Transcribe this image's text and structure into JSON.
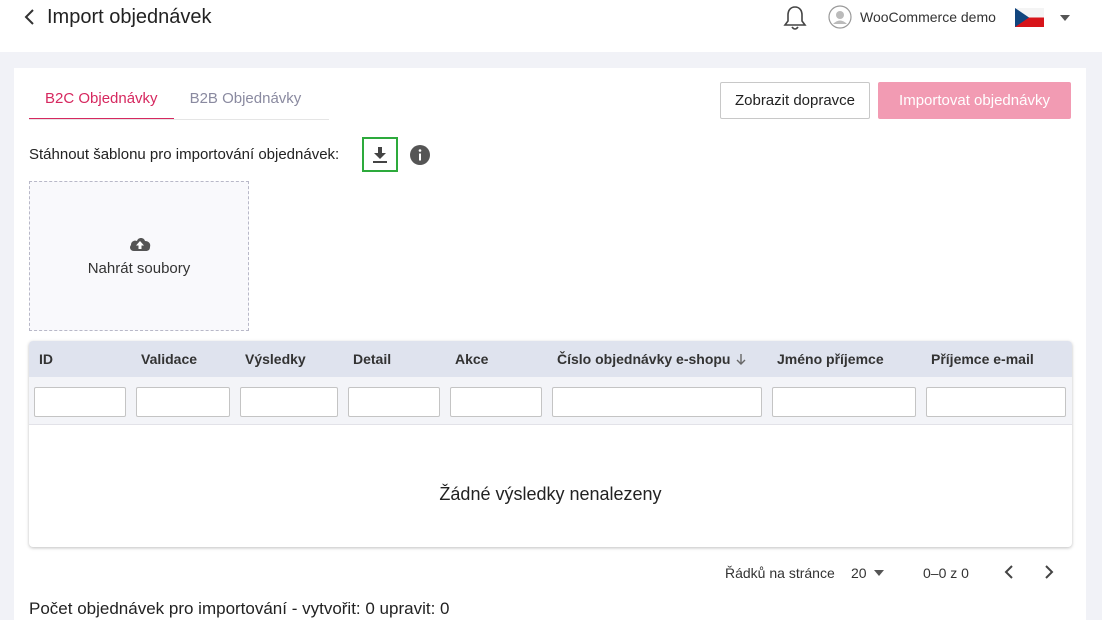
{
  "header": {
    "title": "Import objednávek",
    "user_name": "WooCommerce demo",
    "language_flag": "cz-flag",
    "icons": [
      "back-icon",
      "bell-icon",
      "avatar-icon",
      "chevron-down-icon"
    ]
  },
  "tabs": [
    {
      "label": "B2C Objednávky",
      "active": true
    },
    {
      "label": "B2B Objednávky",
      "active": false
    }
  ],
  "actions": {
    "show_carriers": "Zobrazit dopravce",
    "import_orders": "Importovat objednávky"
  },
  "template": {
    "label": "Stáhnout šablonu pro importování objednávek:",
    "icons": [
      "download-icon",
      "info-icon"
    ]
  },
  "upload": {
    "label": "Nahrát soubory",
    "icon": "cloud-upload-icon"
  },
  "table": {
    "columns": [
      "ID",
      "Validace",
      "Výsledky",
      "Detail",
      "Akce",
      "Číslo objednávky e-shopu",
      "Jméno příjemce",
      "Příjemce e-mail"
    ],
    "sorted_column": "Číslo objednávky e-shopu",
    "filter_values": [
      "",
      "",
      "",
      "",
      "",
      "",
      "",
      ""
    ],
    "empty_message": "Žádné výsledky nenalezeny"
  },
  "pagination": {
    "rows_per_page_label": "Řádků na stránce",
    "rows_per_page": "20",
    "range": "0–0 z 0"
  },
  "summary": "Počet objednávek pro importování - vytvořit: 0 upravit: 0",
  "colors": {
    "accent": "#d6285f",
    "import_button_disabled": "#f29bb3",
    "highlight_border": "#2daa3c",
    "table_header": "#dfe3ee"
  }
}
